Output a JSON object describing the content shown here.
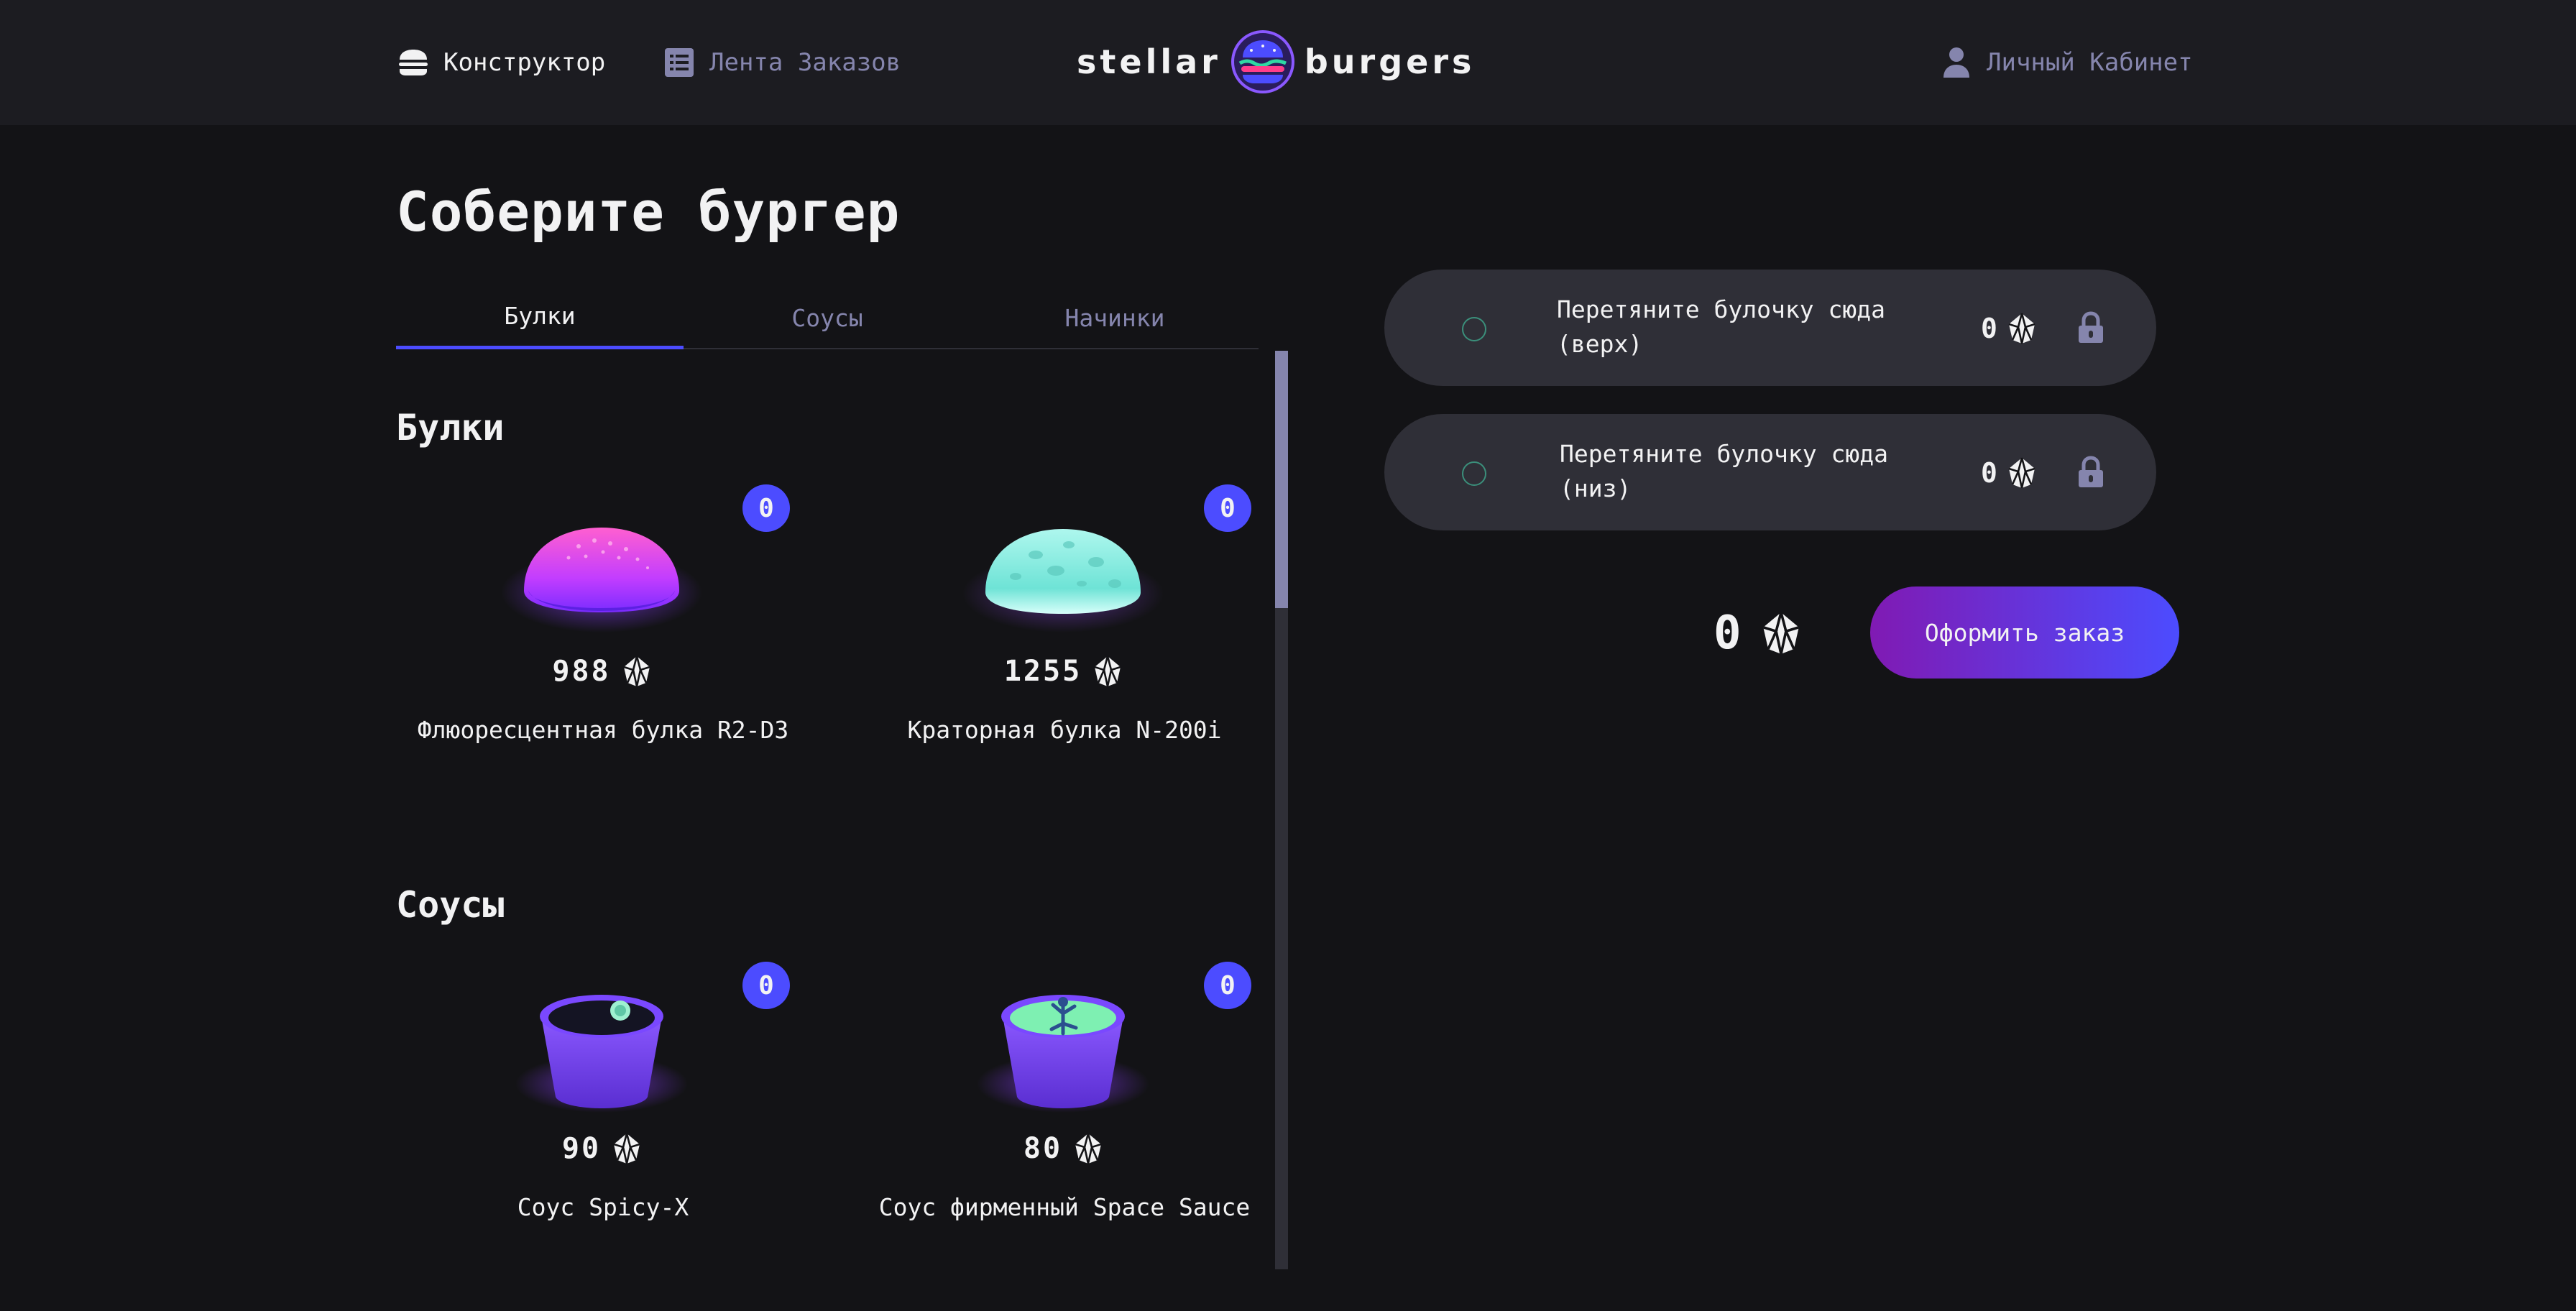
{
  "header": {
    "nav": {
      "constructor_label": "Конструктор",
      "feed_label": "Лента Заказов",
      "account_label": "Личный Кабинет"
    },
    "logo": {
      "left": "stellar",
      "right": "burgers"
    }
  },
  "main": {
    "title": "Соберите бургер",
    "tabs": [
      {
        "label": "Булки",
        "active": true
      },
      {
        "label": "Соусы",
        "active": false
      },
      {
        "label": "Начинки",
        "active": false
      }
    ],
    "sections": [
      {
        "title": "Булки",
        "items": [
          {
            "price": "988",
            "name": "Флюоресцентная булка R2-D3",
            "count": "0",
            "icon": "fluorescent-bun"
          },
          {
            "price": "1255",
            "name": "Краторная булка N-200i",
            "count": "0",
            "icon": "crater-bun"
          }
        ]
      },
      {
        "title": "Соусы",
        "items": [
          {
            "price": "90",
            "name": "Соус Spicy-X",
            "count": "0",
            "icon": "sauce-spicy"
          },
          {
            "price": "80",
            "name": "Соус фирменный Space Sauce",
            "count": "0",
            "icon": "sauce-space"
          }
        ]
      }
    ]
  },
  "constructor": {
    "top_bun": {
      "text": "Перетяните булочку сюда (верх)",
      "price": "0"
    },
    "bottom_bun": {
      "text": "Перетяните булочку сюда (низ)",
      "price": "0"
    },
    "total": "0",
    "order_button": "Оформить заказ"
  },
  "colors": {
    "accent": "#4c4cff",
    "button_gradient_start": "#801ab3",
    "button_gradient_end": "#4c4cff",
    "background": "#131316",
    "header_bg": "#1c1c21",
    "slot_bg": "#2f2f37",
    "inactive_text": "#8585ad"
  }
}
